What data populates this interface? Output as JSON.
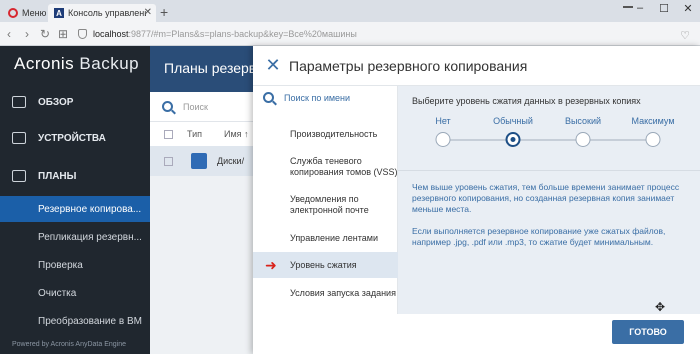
{
  "browser": {
    "tabs": [
      {
        "label": "Меню"
      },
      {
        "label": "Консоль управления резерв"
      }
    ],
    "new_tab": "+",
    "url_host": "localhost",
    "url_rest": ":9877/#m=Plans&s=plans-backup&key=Все%20машины"
  },
  "sidebar": {
    "logo_a": "Acronis",
    "logo_b": "Backup",
    "items": [
      {
        "label": "ОБЗОР",
        "icon": "dashboard-icon"
      },
      {
        "label": "УСТРОЙСТВА",
        "icon": "devices-icon"
      },
      {
        "label": "ПЛАНЫ",
        "icon": "plans-icon"
      }
    ],
    "sub_items": [
      {
        "label": "Резервное копирова..."
      },
      {
        "label": "Репликация резервн..."
      },
      {
        "label": "Проверка"
      },
      {
        "label": "Очистка"
      },
      {
        "label": "Преобразование в ВМ"
      }
    ],
    "powered": "Powered by Acronis AnyData Engine"
  },
  "main": {
    "title": "Планы резерв",
    "search_placeholder": "Поиск",
    "col_type": "Тип",
    "col_name": "Имя ↑",
    "row_name": "Диски/"
  },
  "dialog": {
    "title": "Параметры резервного копирования",
    "search_label": "Поиск по имени",
    "nav_items": [
      {
        "label": "Производительность"
      },
      {
        "label": "Служба теневого копирования томов (VSS)"
      },
      {
        "label": "Уведомления по электронной почте"
      },
      {
        "label": "Управление лентами"
      },
      {
        "label": "Уровень сжатия"
      },
      {
        "label": "Условия запуска задания"
      }
    ],
    "question": "Выберите уровень сжатия данных в резервных копиях",
    "levels": [
      "Нет",
      "Обычный",
      "Высокий",
      "Максимум"
    ],
    "selected_level": "Обычный",
    "info1": "Чем выше уровень сжатия, тем больше времени занимает процесс резервного копирования, но созданная резервная копия занимает меньше места.",
    "info2": "Если выполняется резервное копирование уже сжатых файлов, например .jpg, .pdf или .mp3, то сжатие будет минимальным.",
    "done_label": "ГОТОВО"
  },
  "colors": {
    "sidebar_bg": "#20272f",
    "accent": "#3a6ea5",
    "active_sub": "#1b5fa8"
  }
}
